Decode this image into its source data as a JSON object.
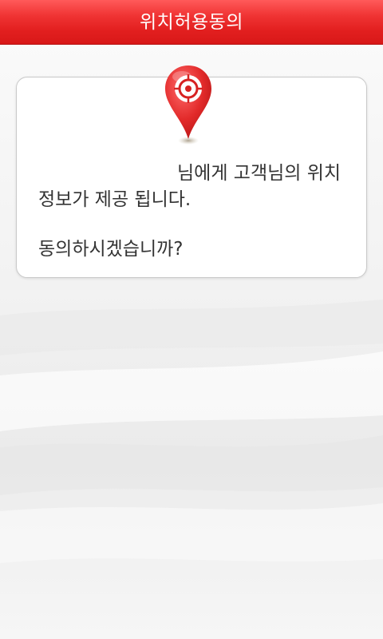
{
  "header": {
    "title": "위치허용동의"
  },
  "dialog": {
    "icon": "map-pin-target-icon",
    "recipient_name": "",
    "message_line1": "님에게 고객님의 위치",
    "message_line2": "정보가 제공 됩니다.",
    "question": "동의하시겠습니까?"
  },
  "colors": {
    "header_red": "#e21f1f",
    "pin_red": "#e22a2a",
    "text": "#333333"
  }
}
